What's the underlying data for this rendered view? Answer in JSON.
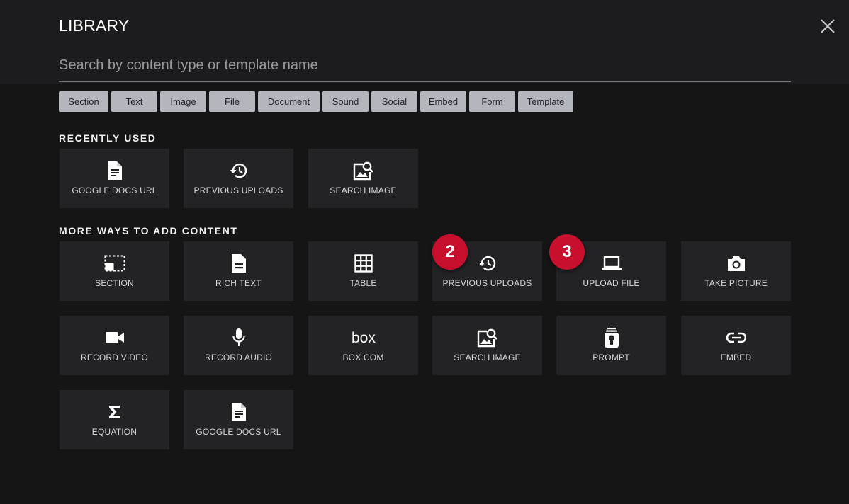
{
  "header": {
    "title": "LIBRARY",
    "search_placeholder": "Search by content type or template name"
  },
  "filters": [
    "Section",
    "Text",
    "Image",
    "File",
    "Document",
    "Sound",
    "Social",
    "Embed",
    "Form",
    "Template"
  ],
  "recently_used": {
    "heading": "RECENTLY USED",
    "items": [
      {
        "label": "GOOGLE DOCS URL",
        "icon": "document-icon"
      },
      {
        "label": "PREVIOUS UPLOADS",
        "icon": "history-icon"
      },
      {
        "label": "SEARCH IMAGE",
        "icon": "image-search-icon"
      }
    ]
  },
  "more_ways": {
    "heading": "MORE WAYS TO ADD CONTENT",
    "items": [
      {
        "label": "SECTION",
        "icon": "section-icon"
      },
      {
        "label": "RICH TEXT",
        "icon": "rich-text-icon"
      },
      {
        "label": "TABLE",
        "icon": "table-icon"
      },
      {
        "label": "PREVIOUS UPLOADS",
        "icon": "history-icon"
      },
      {
        "label": "UPLOAD FILE",
        "icon": "laptop-icon"
      },
      {
        "label": "TAKE PICTURE",
        "icon": "camera-icon"
      },
      {
        "label": "RECORD VIDEO",
        "icon": "video-camera-icon"
      },
      {
        "label": "RECORD AUDIO",
        "icon": "microphone-icon"
      },
      {
        "label": "BOX.COM",
        "icon": "box-logo-icon"
      },
      {
        "label": "SEARCH IMAGE",
        "icon": "image-search-icon"
      },
      {
        "label": "PROMPT",
        "icon": "prompt-icon"
      },
      {
        "label": "EMBED",
        "icon": "link-icon"
      },
      {
        "label": "EQUATION",
        "icon": "sigma-icon"
      },
      {
        "label": "GOOGLE DOCS URL",
        "icon": "document-icon"
      }
    ]
  },
  "annotations": [
    "2",
    "3"
  ],
  "colors": {
    "background": "#151516",
    "tile": "#232325",
    "chip": "#b3b6bd",
    "badge": "#c8102e"
  }
}
